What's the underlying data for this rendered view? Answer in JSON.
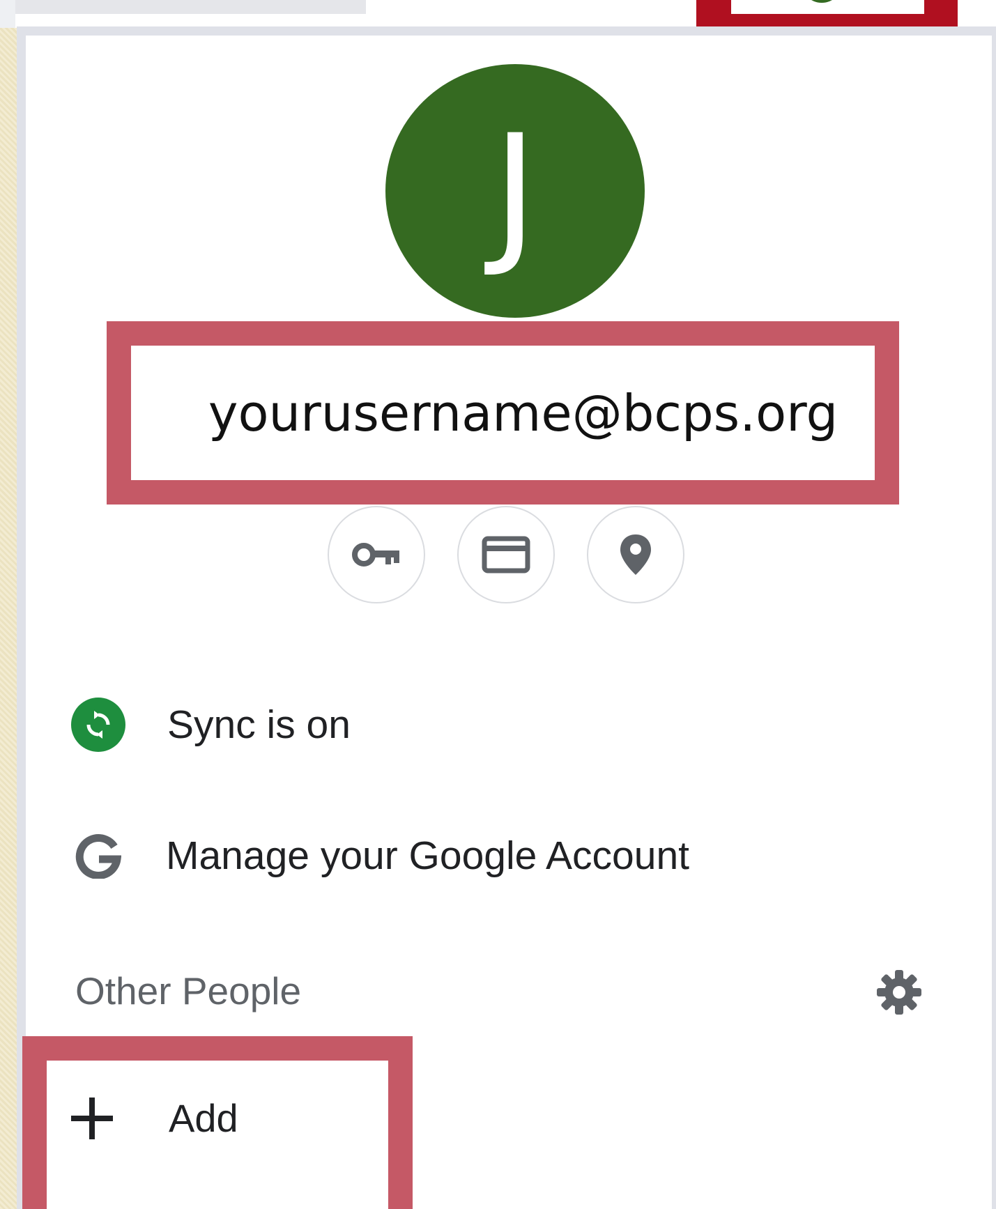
{
  "profile": {
    "avatar_initial": "J",
    "email": "yourusername@bcps.org"
  },
  "quick_icons": [
    "key-icon",
    "credit-card-icon",
    "location-pin-icon"
  ],
  "menu": {
    "sync_label": "Sync is on",
    "manage_label": "Manage your Google Account"
  },
  "other_people": {
    "heading": "Other People",
    "add_label": "Add"
  },
  "colors": {
    "avatar": "#356a21",
    "highlight_frame": "#c55966",
    "top_highlight": "#b01020",
    "sync_green": "#1e8e3e",
    "icon_gray": "#5f6368"
  }
}
